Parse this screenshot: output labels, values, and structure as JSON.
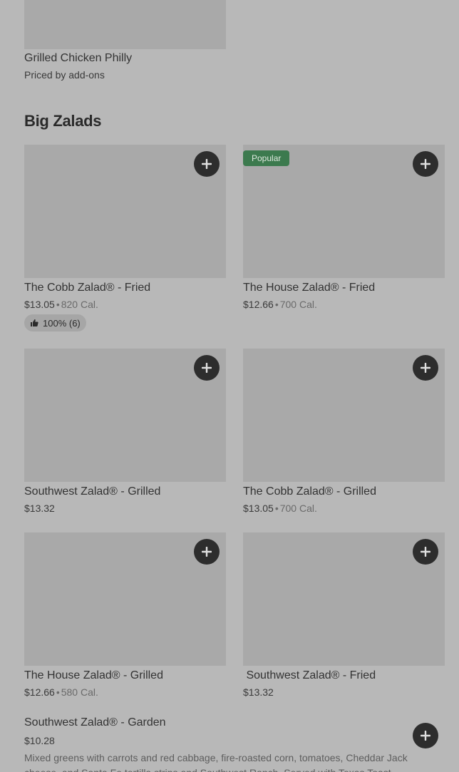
{
  "top_item": {
    "name": "Grilled Chicken Philly",
    "subtitle": "Priced by add-ons"
  },
  "section": {
    "title": "Big Zalads"
  },
  "items": [
    {
      "name": "The Cobb Zalad® - Fried",
      "price": "$13.05",
      "calories": "820 Cal.",
      "rating": "100% (6)"
    },
    {
      "name": "The House Zalad® - Fried",
      "price": "$12.66",
      "calories": "700 Cal.",
      "badge": "Popular"
    },
    {
      "name": "Southwest Zalad® - Grilled",
      "price": "$13.32"
    },
    {
      "name": "The Cobb Zalad® - Grilled",
      "price": "$13.05",
      "calories": "700 Cal."
    },
    {
      "name": "The House Zalad® - Grilled",
      "price": "$12.66",
      "calories": "580 Cal."
    },
    {
      "name": " Southwest Zalad® - Fried",
      "price": "$13.32"
    }
  ],
  "list_item": {
    "name": "Southwest Zalad® - Garden",
    "price": "$10.28",
    "description": "Mixed greens with carrots and red cabbage, fire-roasted corn, tomatoes, Cheddar Jack cheese, and Santa Fe tortilla strips and Southwest Ranch. Served with Texas Toast."
  },
  "separator": "•",
  "icons": {
    "add": "plus-icon",
    "rating": "thumbs-up-icon"
  },
  "colors": {
    "background": "#b8b8b8",
    "image_placeholder": "#a9a9a9",
    "popular_badge": "#3c7a4e",
    "add_button": "#2d2d2d"
  }
}
